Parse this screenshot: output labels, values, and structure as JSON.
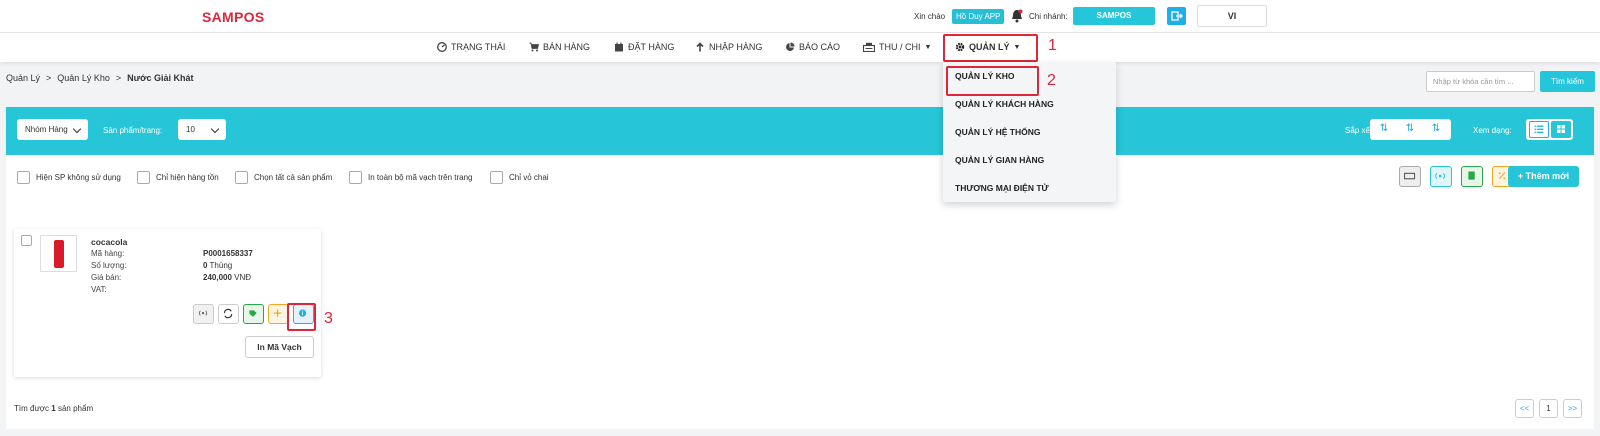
{
  "header": {
    "logo": "SAMPOS",
    "greeting": "Xin chào",
    "user": "Hồ Duy APP",
    "branch_label": "Chi nhánh:",
    "branch": "SAMPOS",
    "language": "VI"
  },
  "nav": {
    "items": [
      {
        "label": "TRẠNG THÁI",
        "icon": "dashboard-icon"
      },
      {
        "label": "BÁN HÀNG",
        "icon": "cart-icon"
      },
      {
        "label": "ĐẶT HÀNG",
        "icon": "calendar-icon"
      },
      {
        "label": "NHẬP HÀNG",
        "icon": "arrow-up-icon"
      },
      {
        "label": "BÁO CÁO",
        "icon": "pie-chart-icon"
      },
      {
        "label": "THU / CHI",
        "icon": "cash-register-icon"
      },
      {
        "label": "QUẢN LÝ",
        "icon": "gear-icon"
      }
    ]
  },
  "dropdown": {
    "items": [
      "QUẢN LÝ KHO",
      "QUẢN LÝ KHÁCH HÀNG",
      "QUẢN LÝ HỆ THỐNG",
      "QUẢN LÝ GIAN HÀNG",
      "THƯƠNG MẠI ĐIỆN TỬ"
    ]
  },
  "annotations": [
    "1",
    "2",
    "3"
  ],
  "breadcrumb": {
    "items": [
      "Quản Lý",
      "Quản Lý Kho",
      "Nước Giải Khát"
    ],
    "separator": ">"
  },
  "search": {
    "placeholder": "Nhập từ khóa cần tìm ...",
    "button": "Tìm kiếm"
  },
  "toolbar": {
    "group_select": "Nhóm Hàng",
    "per_page_label": "Sản phẩm/trang:",
    "per_page_value": "10",
    "sort_label": "Sắp xếp:",
    "view_label": "Xem dạng:"
  },
  "filters": [
    "Hiện SP không sử dụng",
    "Chỉ hiện hàng tồn",
    "Chọn tất cả sản phẩm",
    "In toàn bộ mã vạch trên trang",
    "Chỉ vỏ chai"
  ],
  "add_button": "+ Thêm mới",
  "product": {
    "name": "cocacola",
    "code_label": "Mã hàng:",
    "code": "P0001658337",
    "qty_label": "Số lượng:",
    "qty": "0",
    "qty_unit": "Thùng",
    "price_label": "Giá bán:",
    "price": "240,000",
    "currency": "VNĐ",
    "vat_label": "VAT:",
    "barcode_button": "In Mã Vạch"
  },
  "footer": {
    "found_prefix": "Tìm được",
    "found_count": "1",
    "found_suffix": "sản phẩm",
    "pagination": [
      "<<",
      "1",
      ">>"
    ]
  },
  "colors": {
    "brand": "#e0263a",
    "teal": "#26c6d8",
    "blue": "#1eaee8"
  }
}
